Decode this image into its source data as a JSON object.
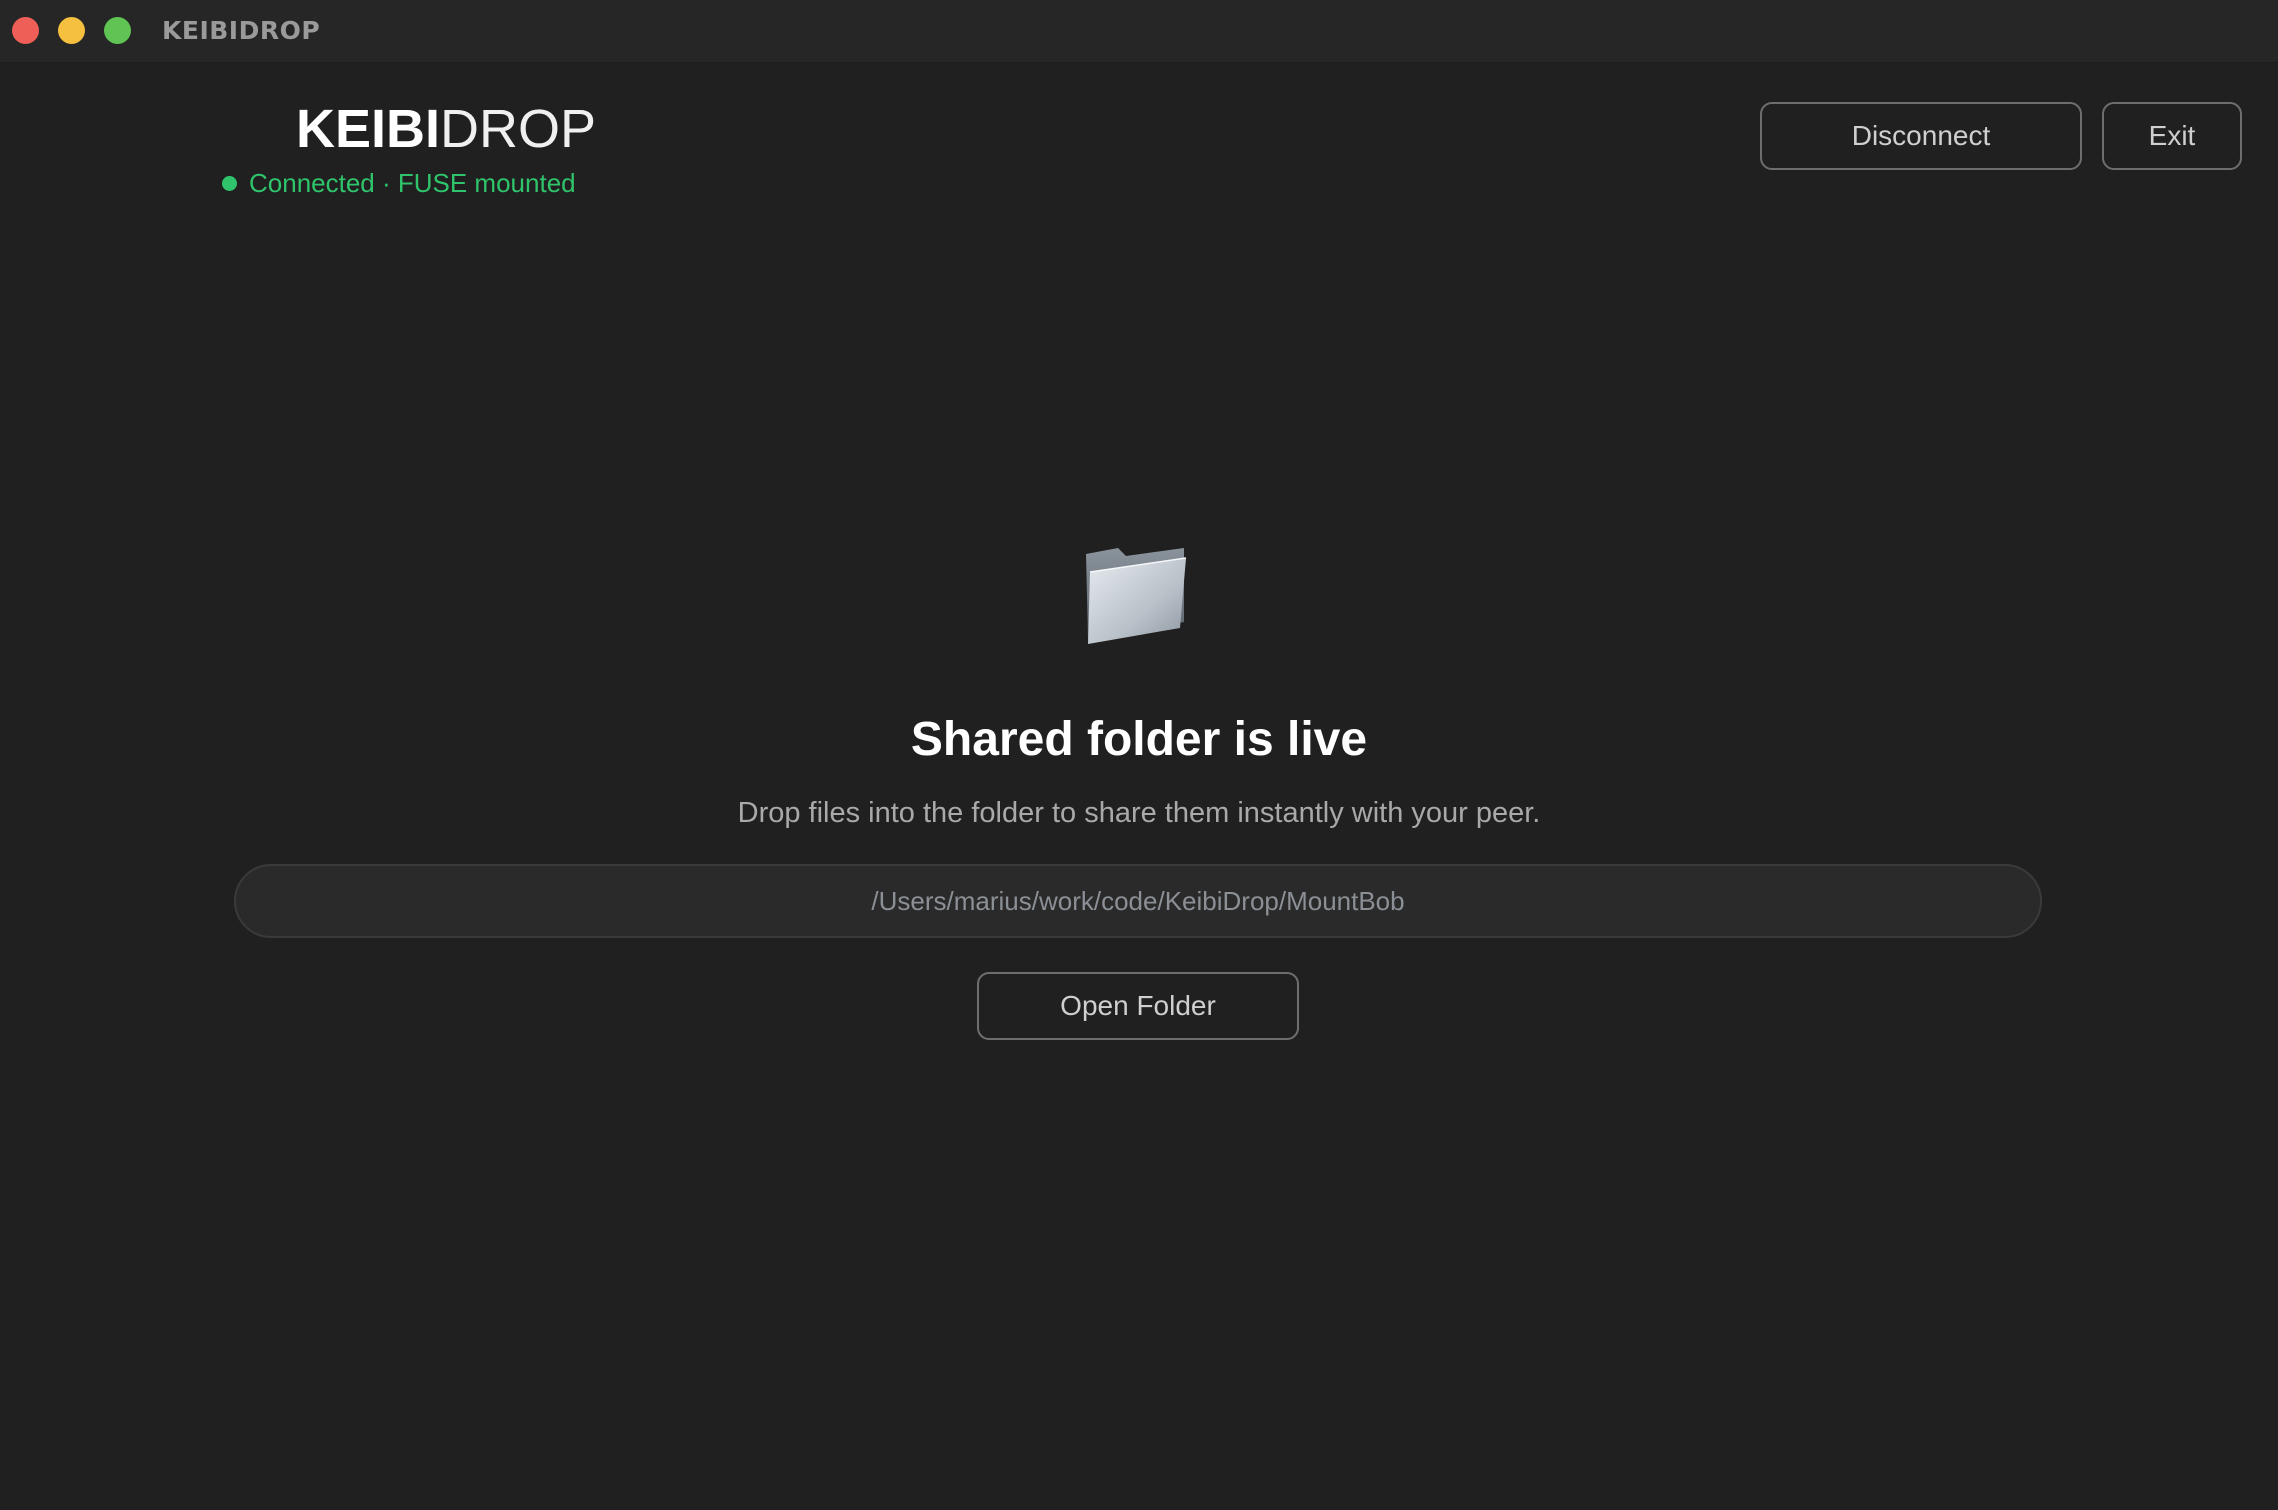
{
  "window": {
    "title": "KEIBIDROP",
    "controls": [
      "close",
      "minimize",
      "maximize"
    ]
  },
  "header": {
    "brand_bold": "KEIBI",
    "brand_light": "DROP",
    "status_text": "Connected · FUSE mounted",
    "status_color": "#2fc46b",
    "disconnect_label": "Disconnect",
    "exit_label": "Exit"
  },
  "main": {
    "icon": "folder-icon",
    "headline": "Shared folder is live",
    "subline": "Drop files into the folder to share them instantly with your peer.",
    "mount_path": "/Users/marius/work/code/KeibiDrop/MountBob",
    "open_folder_label": "Open Folder"
  },
  "colors": {
    "background": "#202020",
    "accent_green": "#2fc46b",
    "close": "#ee5f57",
    "minimize": "#f5bf3f",
    "maximize": "#5fc453"
  }
}
